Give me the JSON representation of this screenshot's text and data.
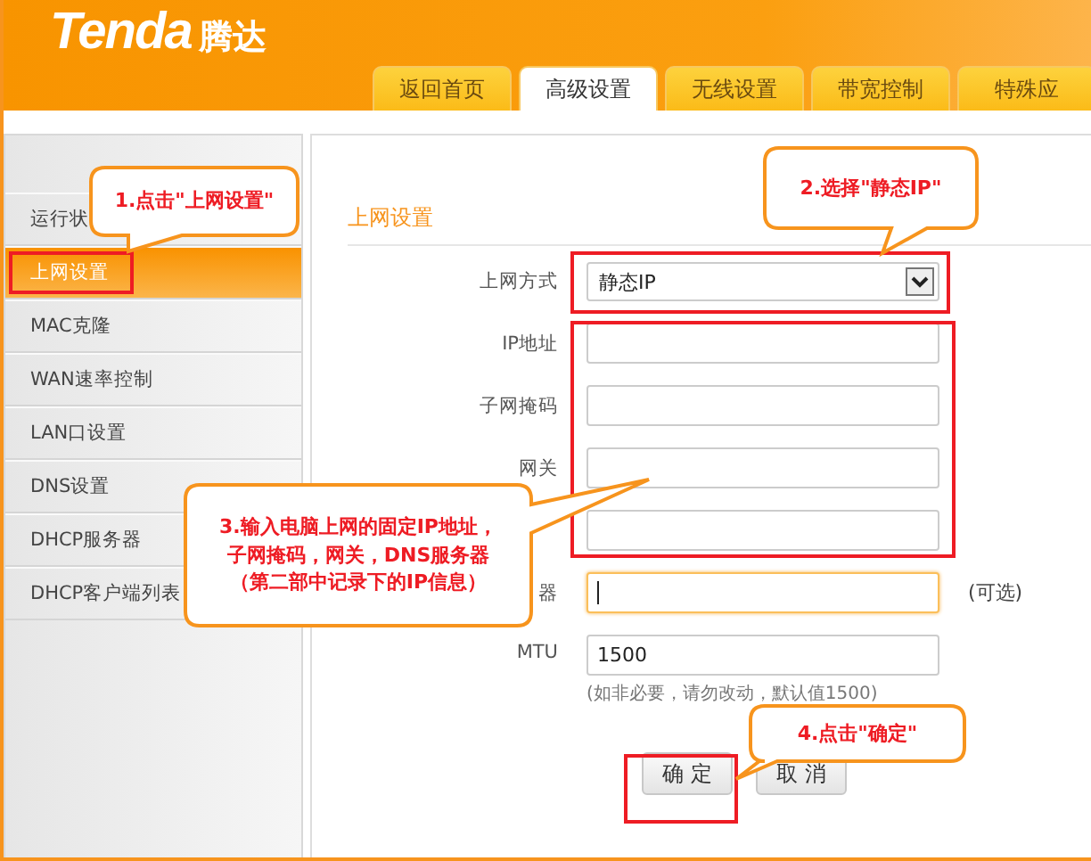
{
  "header": {
    "logo": "Tenda",
    "logo_cn": "腾达"
  },
  "tabs": [
    {
      "label": "返回首页",
      "selected": false
    },
    {
      "label": "高级设置",
      "selected": true
    },
    {
      "label": "无线设置",
      "selected": false
    },
    {
      "label": "带宽控制",
      "selected": false
    },
    {
      "label": "特殊应",
      "selected": false
    }
  ],
  "sidebar": {
    "items": [
      {
        "label": "运行状",
        "selected": false
      },
      {
        "label": "上网设置",
        "selected": true
      },
      {
        "label": "MAC克隆",
        "selected": false
      },
      {
        "label": "WAN速率控制",
        "selected": false
      },
      {
        "label": "LAN口设置",
        "selected": false
      },
      {
        "label": "DNS设置",
        "selected": false
      },
      {
        "label": "DHCP服务器",
        "selected": false
      },
      {
        "label": "DHCP客户端列表",
        "selected": false
      }
    ]
  },
  "section_title": "上网设置",
  "form": {
    "rows": [
      {
        "kind": "select",
        "label": "上网方式",
        "value": "静态IP"
      },
      {
        "kind": "input",
        "label": "IP地址",
        "focused": false
      },
      {
        "kind": "input",
        "label": "子网掩码",
        "focused": false
      },
      {
        "kind": "input",
        "label": "网关",
        "focused": false
      },
      {
        "kind": "input",
        "focused": false
      },
      {
        "kind": "input",
        "label": "器",
        "focused": true,
        "suffix": "(可选)"
      },
      {
        "kind": "input",
        "label": "MTU",
        "value": "1500",
        "focused": false,
        "hint": "(如非必要，请勿改动，默认值1500)"
      }
    ]
  },
  "buttons": [
    {
      "label": "确 定"
    },
    {
      "label": "取 消"
    }
  ],
  "callouts": [
    {
      "lines": [
        "1.点击\"上网设置\""
      ]
    },
    {
      "lines": [
        "2.选择\"静态IP\""
      ]
    },
    {
      "lines": [
        "3.输入电脑上网的固定IP地址，",
        "子网掩码，网关，DNS服务器",
        "（第二部中记录下的IP信息）"
      ]
    },
    {
      "lines": [
        "4.点击\"确定\""
      ]
    }
  ]
}
